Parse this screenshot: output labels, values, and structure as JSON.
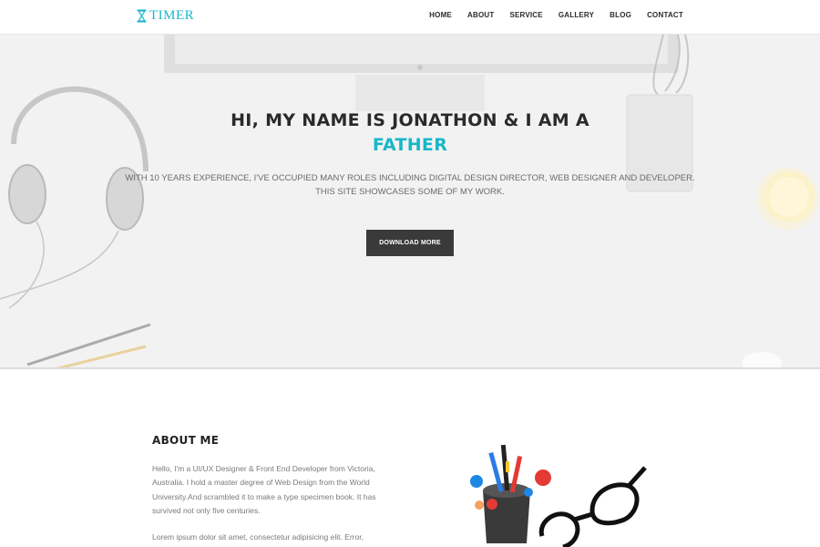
{
  "header": {
    "logo_text": "TIMER",
    "nav": [
      "HOME",
      "ABOUT",
      "SERVICE",
      "GALLERY",
      "BLOG",
      "CONTACT"
    ]
  },
  "hero": {
    "title": "HI, MY NAME IS JONATHON & I AM A",
    "role": "FATHER",
    "description_line1": "WITH 10 YEARS EXPERIENCE, I'VE OCCUPIED MANY ROLES INCLUDING DIGITAL DESIGN DIRECTOR, WEB DESIGNER AND DEVELOPER.",
    "description_line2": "THIS SITE SHOWCASES SOME OF MY WORK.",
    "button_label": "DOWNLOAD MORE"
  },
  "about": {
    "title": "ABOUT ME",
    "paragraph1": "Hello, I'm a UI/UX Designer & Front End Developer from Victoria, Australia. I hold a master degree of Web Design from the World University.And scrambled it to make a type specimen book. It has survived not only five centuries.",
    "paragraph2": "Lorem ipsum dolor sit amet, consectetur adipisicing elit. Error,"
  },
  "colors": {
    "accent": "#19b6c9",
    "button_bg": "#3a3a3a",
    "hero_bg": "#f2f2f2"
  },
  "icons": {
    "logo": "hourglass-icon"
  }
}
